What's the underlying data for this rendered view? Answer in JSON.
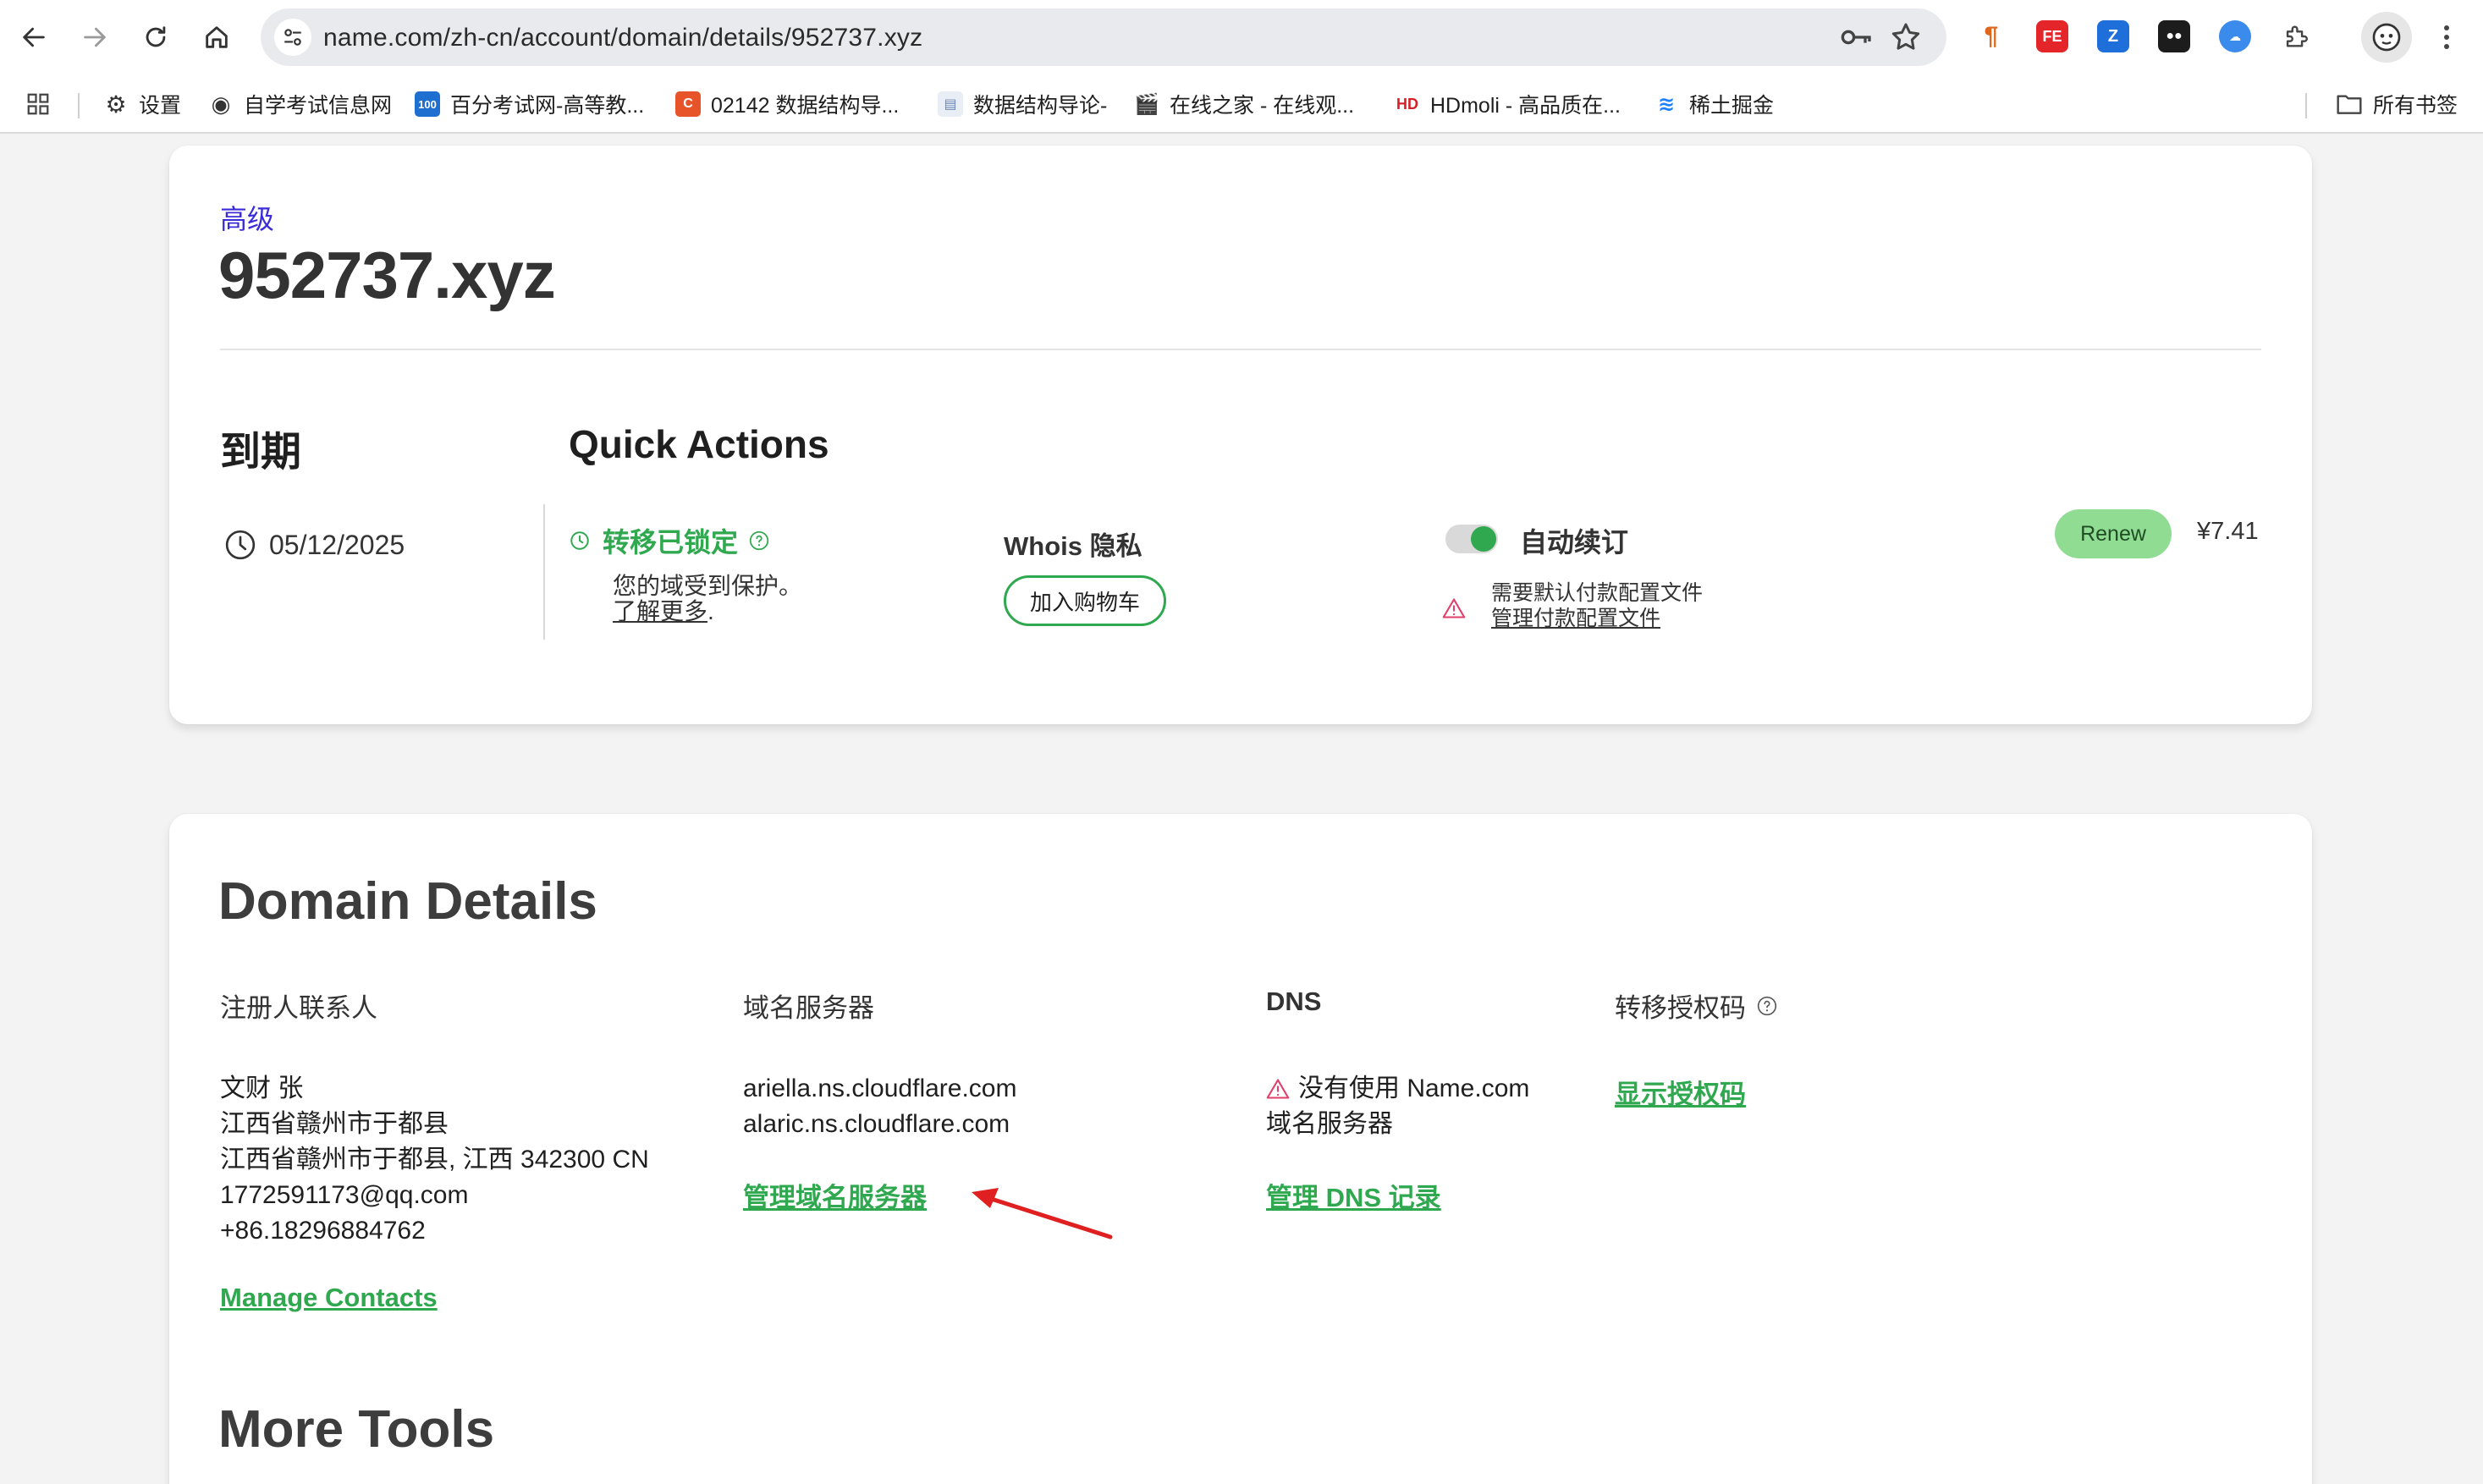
{
  "browser": {
    "url": "name.com/zh-cn/account/domain/details/952737.xyz",
    "bookmarks": [
      {
        "label": "设置",
        "icon": "gear-icon"
      },
      {
        "label": "自学考试信息网",
        "icon": "globe-icon"
      },
      {
        "label": "百分考试网-高等教...",
        "icon": "site-100-icon"
      },
      {
        "label": "02142 数据结构导...",
        "icon": "site-c-icon"
      },
      {
        "label": "数据结构导论-",
        "icon": "doc-icon"
      },
      {
        "label": "在线之家 - 在线观...",
        "icon": "clapper-icon"
      },
      {
        "label": "HDmoli - 高品质在...",
        "icon": "site-hd-icon"
      },
      {
        "label": "稀土掘金",
        "icon": "juejin-icon"
      }
    ],
    "all_bookmarks_label": "所有书签",
    "colors": {
      "accent_green": "#2fa84f",
      "tier_purple": "#3b2cd9",
      "renew_green": "#8fdc92"
    }
  },
  "domain": {
    "tier": "高级",
    "name": "952737.xyz",
    "expiry_heading": "到期",
    "expiry_date": "05/12/2025"
  },
  "quick_actions": {
    "heading": "Quick Actions",
    "lock": {
      "title": "转移已锁定",
      "desc": "您的域受到保护。",
      "learn_more": "了解更多",
      "learn_more_suffix": "."
    },
    "whois": {
      "title": "Whois 隐私",
      "button": "加入购物车"
    },
    "auto_renew": {
      "title": "自动续订",
      "enabled": true,
      "warning": "需要默认付款配置文件",
      "manage_link": "管理付款配置文件"
    },
    "renew": {
      "button": "Renew",
      "price": "¥7.41"
    }
  },
  "details": {
    "heading": "Domain Details",
    "registrant": {
      "heading": "注册人联系人",
      "lines": [
        "文财 张",
        "江西省赣州市于都县",
        "江西省赣州市于都县, 江西 342300 CN",
        "1772591173@qq.com",
        "+86.18296884762"
      ],
      "link": "Manage Contacts"
    },
    "nameservers": {
      "heading": "域名服务器",
      "lines": [
        "ariella.ns.cloudflare.com",
        "alaric.ns.cloudflare.com"
      ],
      "link": "管理域名服务器"
    },
    "dns": {
      "heading": "DNS",
      "warning_line1": "没有使用 Name.com",
      "warning_line2": "域名服务器",
      "link": "管理 DNS 记录"
    },
    "auth_code": {
      "heading": "转移授权码",
      "link": "显示授权码"
    }
  },
  "more_tools": {
    "heading": "More Tools"
  }
}
